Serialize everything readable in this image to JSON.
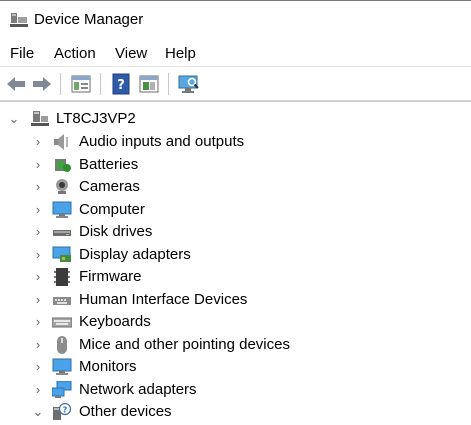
{
  "window": {
    "title": "Device Manager",
    "icon": "device-manager-icon"
  },
  "menu": {
    "items": [
      "File",
      "Action",
      "View",
      "Help"
    ]
  },
  "toolbar": {
    "buttons": [
      "back-arrow-icon",
      "forward-arrow-icon",
      "properties-icon",
      "help-icon",
      "update-driver-icon",
      "scan-hardware-icon"
    ]
  },
  "tree": {
    "root": {
      "label": "LT8CJ3VP2",
      "expanded": true,
      "icon": "computer-tower-icon"
    },
    "categories": [
      {
        "label": "Audio inputs and outputs",
        "icon": "speaker-icon",
        "expanded": false
      },
      {
        "label": "Batteries",
        "icon": "battery-icon",
        "expanded": false
      },
      {
        "label": "Cameras",
        "icon": "camera-icon",
        "expanded": false
      },
      {
        "label": "Computer",
        "icon": "monitor-icon",
        "expanded": false
      },
      {
        "label": "Disk drives",
        "icon": "disk-drive-icon",
        "expanded": false
      },
      {
        "label": "Display adapters",
        "icon": "display-adapter-icon",
        "expanded": false
      },
      {
        "label": "Firmware",
        "icon": "firmware-chip-icon",
        "expanded": false
      },
      {
        "label": "Human Interface Devices",
        "icon": "hid-keyboard-icon",
        "expanded": false
      },
      {
        "label": "Keyboards",
        "icon": "keyboard-icon",
        "expanded": false
      },
      {
        "label": "Mice and other pointing devices",
        "icon": "mouse-icon",
        "expanded": false
      },
      {
        "label": "Monitors",
        "icon": "monitor-icon",
        "expanded": false
      },
      {
        "label": "Network adapters",
        "icon": "network-adapter-icon",
        "expanded": false
      },
      {
        "label": "Other devices",
        "icon": "unknown-device-icon",
        "expanded": true
      }
    ]
  }
}
